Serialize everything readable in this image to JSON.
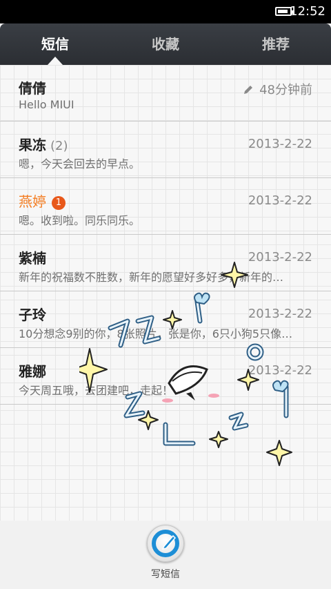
{
  "status_bar": {
    "time": "12:52",
    "battery_level": 0.85
  },
  "tabs": [
    {
      "label": "短信",
      "active": true
    },
    {
      "label": "收藏",
      "active": false
    },
    {
      "label": "推荐",
      "active": false
    }
  ],
  "conversations": [
    {
      "name": "倩倩",
      "count": "",
      "badge": "",
      "preview": "Hello MIUI",
      "time": "48分钟前",
      "draft": true,
      "unread": false
    },
    {
      "name": "果冻",
      "count": "(2)",
      "badge": "",
      "preview": "嗯，今天会回去的早点。",
      "time": "2013-2-22",
      "draft": false,
      "unread": false
    },
    {
      "name": "燕婷",
      "count": "",
      "badge": "1",
      "preview": "嗯。收到啦。同乐同乐。",
      "time": "2013-2-22",
      "draft": false,
      "unread": true
    },
    {
      "name": "紫楠",
      "count": "",
      "badge": "",
      "preview": "新年的祝福数不胜数，新年的愿望好多好多，新年的…",
      "time": "2013-2-22",
      "draft": false,
      "unread": false
    },
    {
      "name": "子玲",
      "count": "",
      "badge": "",
      "preview": "10分想念9别的你，8张照片，张是你，6只小狗5只像…",
      "time": "2013-2-22",
      "draft": false,
      "unread": false
    },
    {
      "name": "雅娜",
      "count": "",
      "badge": "",
      "preview": "今天周五哦，去团建吧，走起！",
      "time": "2013-2-22",
      "draft": false,
      "unread": false
    }
  ],
  "compose": {
    "label": "写短信",
    "icon": "pen-circle-icon"
  },
  "colors": {
    "accent": "#f47c20",
    "badge": "#e8581a",
    "tab_bar": "#2f3237",
    "compose_icon": "#1d8ed6"
  }
}
